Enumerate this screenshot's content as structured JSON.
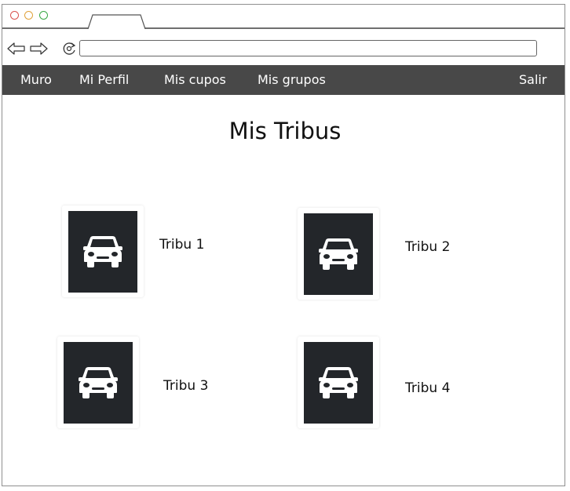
{
  "browser": {
    "address_value": ""
  },
  "nav": {
    "items": [
      {
        "label": "Muro"
      },
      {
        "label": "Mi Perfil"
      },
      {
        "label": "Mis cupos"
      },
      {
        "label": "Mis grupos"
      },
      {
        "label": "Salir"
      }
    ]
  },
  "page": {
    "title": "Mis Tribus"
  },
  "tribes": [
    {
      "label": "Tribu 1",
      "icon": "car-icon"
    },
    {
      "label": "Tribu 2",
      "icon": "car-icon"
    },
    {
      "label": "Tribu 3",
      "icon": "car-icon"
    },
    {
      "label": "Tribu 4",
      "icon": "car-icon"
    }
  ],
  "colors": {
    "navbar": "#484848",
    "thumb_bg": "#23262a",
    "dot_red": "#d9534f",
    "dot_yellow": "#e0a13a",
    "dot_green": "#39a845"
  }
}
